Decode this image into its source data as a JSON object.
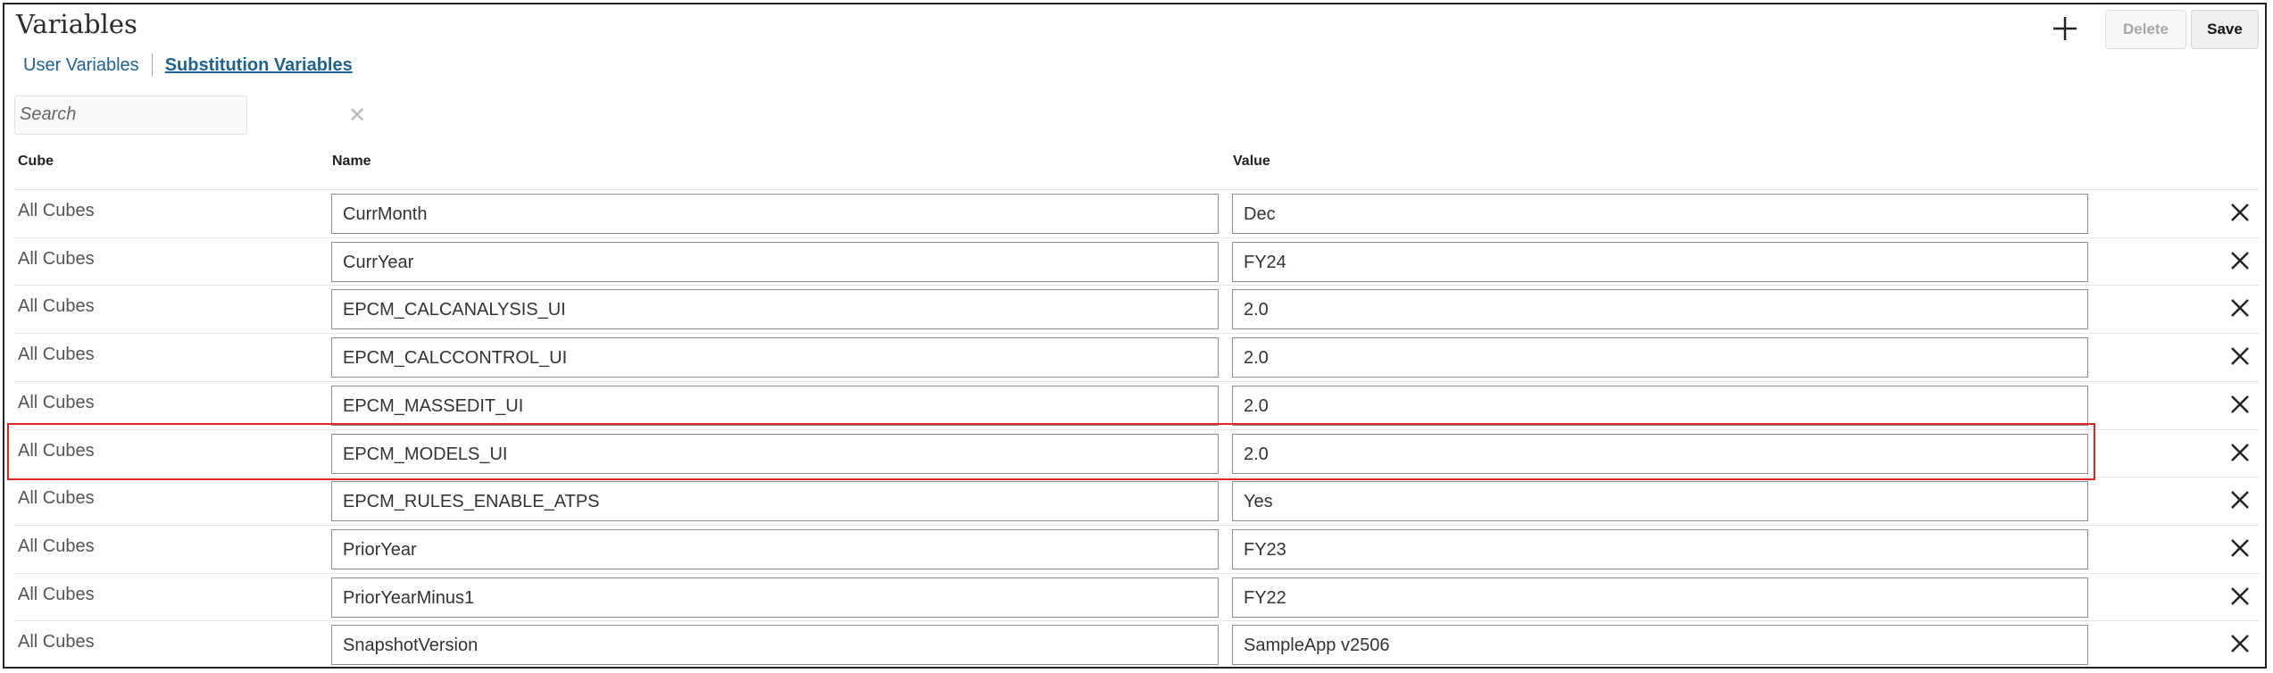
{
  "title": "Variables",
  "tabs": [
    {
      "label": "User Variables",
      "active": false
    },
    {
      "label": "Substitution Variables",
      "active": true
    }
  ],
  "search": {
    "placeholder": "Search",
    "clear_icon": "close-icon"
  },
  "toolbar": {
    "add_icon": "plus-icon",
    "delete_label": "Delete",
    "save_label": "Save"
  },
  "columns": {
    "cube": "Cube",
    "name": "Name",
    "value": "Value"
  },
  "colors": {
    "link": "#1e6295",
    "highlight": "#e02424"
  },
  "rows": [
    {
      "cube": "All Cubes",
      "name": "CurrMonth",
      "value": "Dec"
    },
    {
      "cube": "All Cubes",
      "name": "CurrYear",
      "value": "FY24"
    },
    {
      "cube": "All Cubes",
      "name": "EPCM_CALCANALYSIS_UI",
      "value": "2.0"
    },
    {
      "cube": "All Cubes",
      "name": "EPCM_CALCCONTROL_UI",
      "value": "2.0"
    },
    {
      "cube": "All Cubes",
      "name": "EPCM_MASSEDIT_UI",
      "value": "2.0"
    },
    {
      "cube": "All Cubes",
      "name": "EPCM_MODELS_UI",
      "value": "2.0",
      "highlighted": true
    },
    {
      "cube": "All Cubes",
      "name": "EPCM_RULES_ENABLE_ATPS",
      "value": "Yes"
    },
    {
      "cube": "All Cubes",
      "name": "PriorYear",
      "value": "FY23"
    },
    {
      "cube": "All Cubes",
      "name": "PriorYearMinus1",
      "value": "FY22"
    },
    {
      "cube": "All Cubes",
      "name": "SnapshotVersion",
      "value": "SampleApp v2506"
    }
  ]
}
